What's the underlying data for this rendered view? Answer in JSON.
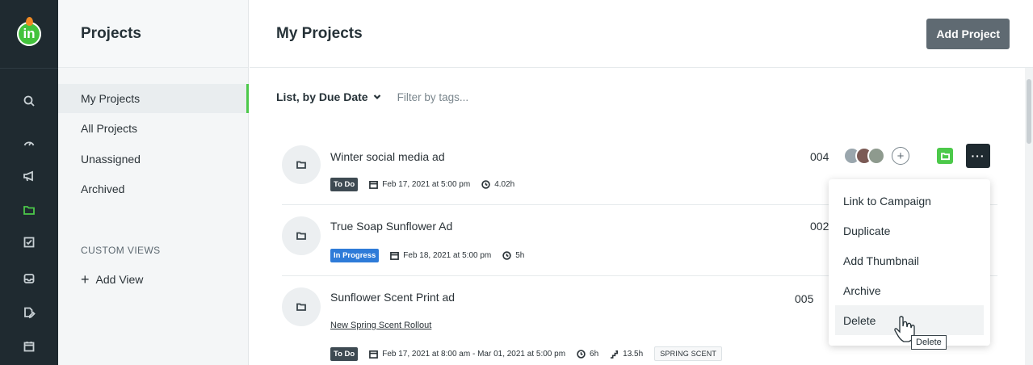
{
  "sidebar": {
    "title": "Projects",
    "items": [
      {
        "label": "My Projects",
        "active": true
      },
      {
        "label": "All Projects"
      },
      {
        "label": "Unassigned"
      },
      {
        "label": "Archived"
      }
    ],
    "section_label": "CUSTOM VIEWS",
    "add_view": "Add View"
  },
  "rail": {
    "icons": [
      "search-icon",
      "dashboard-icon",
      "megaphone-icon",
      "folder-icon",
      "checkbox-icon",
      "inbox-icon",
      "document-edit-icon",
      "calendar-icon"
    ],
    "active": "folder-icon",
    "accent": "#4cc94a"
  },
  "header": {
    "title": "My Projects",
    "add_button": "Add Project"
  },
  "filters": {
    "sort": "List, by Due Date",
    "tag_placeholder": "Filter by tags..."
  },
  "projects": [
    {
      "title": "Winter social media ad",
      "status": "To Do",
      "due": "Feb 17, 2021 at 5:00 pm",
      "time": "4.02h",
      "number": "004"
    },
    {
      "title": "True Soap Sunflower Ad",
      "status": "In Progress",
      "due": "Feb 18, 2021 at 5:00 pm",
      "time": "5h",
      "number": "002"
    },
    {
      "title": "Sunflower Scent Print ad",
      "campaign": "New Spring Scent Rollout",
      "status": "To Do",
      "due": "Feb 17, 2021 at 8:00 am - Mar 01, 2021 at 5:00 pm",
      "time": "6h",
      "estimate": "13.5h",
      "tag": "SPRING SCENT",
      "number": "005"
    }
  ],
  "menu": {
    "items": [
      "Link to Campaign",
      "Duplicate",
      "Add Thumbnail",
      "Archive",
      "Delete"
    ],
    "hovered": "Delete",
    "tooltip": "Delete"
  },
  "more_button": "···",
  "colors": {
    "rail_bg": "#1f2a30",
    "todo": "#3e4a52",
    "in_progress": "#2e7bd8",
    "green": "#4cc94a"
  }
}
